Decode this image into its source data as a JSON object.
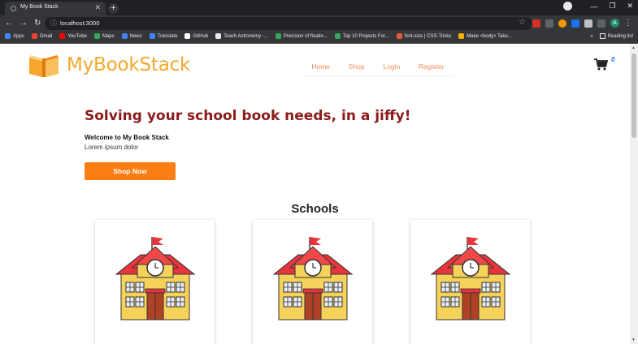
{
  "browser": {
    "tab_title": "My Book Stack",
    "url": "localhost:3000",
    "bookmarks": [
      {
        "label": "Apps",
        "color": "#4285f4"
      },
      {
        "label": "Gmail",
        "color": "#ea4335"
      },
      {
        "label": "YouTube",
        "color": "#ff0000"
      },
      {
        "label": "Maps",
        "color": "#34a853"
      },
      {
        "label": "News",
        "color": "#4285f4"
      },
      {
        "label": "Translate",
        "color": "#4285f4"
      },
      {
        "label": "GitHub",
        "color": "#ffffff"
      },
      {
        "label": "Teach Astronomy -...",
        "color": "#e8eaed"
      },
      {
        "label": "Precision of floatin...",
        "color": "#34a853"
      },
      {
        "label": "Top 10 Projects For...",
        "color": "#34a853"
      },
      {
        "label": "font-size | CSS-Tricks",
        "color": "#e35a3a"
      },
      {
        "label": "Make <body> Take...",
        "color": "#f4b400"
      }
    ],
    "reading_list": "Reading list",
    "profile_initial": "A"
  },
  "site": {
    "brand": "MyBookStack",
    "brand_color": "#f5a72d",
    "nav": [
      "Home",
      "Shop",
      "Login",
      "Register"
    ],
    "cart_count": "0",
    "hero": {
      "title": "Solving your school book needs, in a jiffy!",
      "welcome": "Welcome to My Book Stack",
      "lorem": "Lorem ipsum dolor",
      "button": "Shop Now"
    },
    "schools_heading": "Schools",
    "accent": "#fb7d14",
    "title_color": "#8b1a1a"
  }
}
